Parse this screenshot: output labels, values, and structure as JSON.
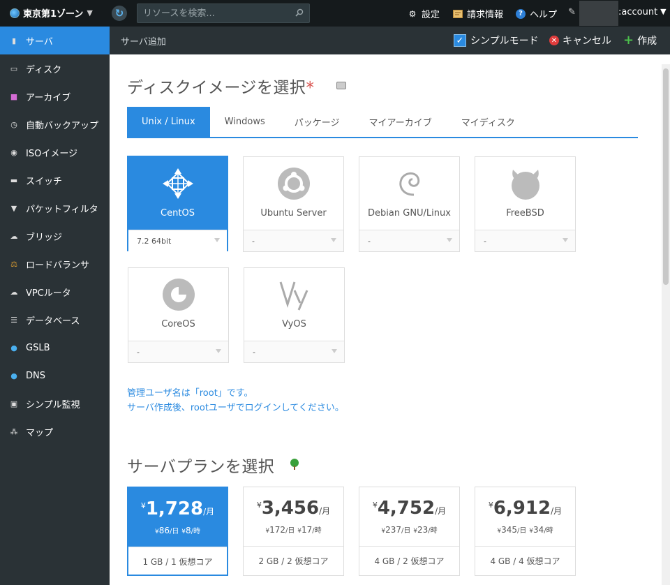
{
  "topbar": {
    "zone": "東京第1ゾーン",
    "search_placeholder": "リソースを検索...",
    "settings": "設定",
    "billing": "請求情報",
    "help": "ヘルプ",
    "account": ":account"
  },
  "sidebar": {
    "items": [
      {
        "label": "サーバ",
        "icon": "server-icon"
      },
      {
        "label": "ディスク",
        "icon": "disk-icon"
      },
      {
        "label": "アーカイブ",
        "icon": "archive-icon"
      },
      {
        "label": "自動バックアップ",
        "icon": "clock-icon"
      },
      {
        "label": "ISOイメージ",
        "icon": "cd-icon"
      },
      {
        "label": "スイッチ",
        "icon": "switch-icon"
      },
      {
        "label": "パケットフィルタ",
        "icon": "filter-icon"
      },
      {
        "label": "ブリッジ",
        "icon": "bridge-icon"
      },
      {
        "label": "ロードバランサ",
        "icon": "balance-icon"
      },
      {
        "label": "VPCルータ",
        "icon": "cloud-icon"
      },
      {
        "label": "データベース",
        "icon": "database-icon"
      },
      {
        "label": "GSLB",
        "icon": "globe-icon"
      },
      {
        "label": "DNS",
        "icon": "globe-icon"
      },
      {
        "label": "シンプル監視",
        "icon": "monitor-icon"
      },
      {
        "label": "マップ",
        "icon": "map-icon"
      }
    ]
  },
  "toolbar": {
    "page_title": "サーバ追加",
    "simple_mode": "シンプルモード",
    "cancel": "キャンセル",
    "create": "作成"
  },
  "disk_image": {
    "title": "ディスクイメージを選択",
    "required_mark": "*",
    "tabs": [
      "Unix / Linux",
      "Windows",
      "パッケージ",
      "マイアーカイブ",
      "マイディスク"
    ],
    "os": [
      {
        "name": "CentOS",
        "version": "7.2 64bit"
      },
      {
        "name": "Ubuntu Server",
        "version": "-"
      },
      {
        "name": "Debian GNU/Linux",
        "version": "-"
      },
      {
        "name": "FreeBSD",
        "version": "-"
      },
      {
        "name": "CoreOS",
        "version": "-"
      },
      {
        "name": "VyOS",
        "version": "-"
      }
    ],
    "note_line1": "管理ユーザ名は「root」です。",
    "note_line2": "サーバ作成後、rootユーザでログインしてください。"
  },
  "plan": {
    "title": "サーバプランを選択",
    "plans": [
      {
        "yen": "¥",
        "amount": "1,728",
        "per": "/月",
        "daily": "86",
        "day_unit": "/日",
        "hourly": "8",
        "hour_unit": "/時",
        "spec": "1 GB / 1 仮想コア"
      },
      {
        "yen": "¥",
        "amount": "3,456",
        "per": "/月",
        "daily": "172",
        "day_unit": "/日",
        "hourly": "17",
        "hour_unit": "/時",
        "spec": "2 GB / 2 仮想コア"
      },
      {
        "yen": "¥",
        "amount": "4,752",
        "per": "/月",
        "daily": "237",
        "day_unit": "/日",
        "hourly": "23",
        "hour_unit": "/時",
        "spec": "4 GB / 2 仮想コア"
      },
      {
        "yen": "¥",
        "amount": "6,912",
        "per": "/月",
        "daily": "345",
        "day_unit": "/日",
        "hourly": "34",
        "hour_unit": "/時",
        "spec": "4 GB / 4 仮想コア"
      }
    ]
  }
}
